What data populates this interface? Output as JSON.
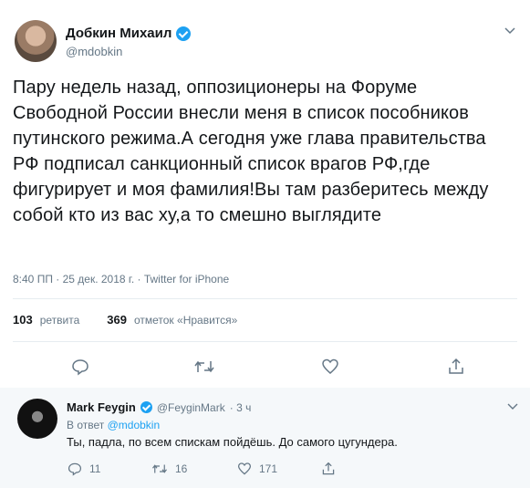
{
  "main_tweet": {
    "author_name": "Добкин Михаил",
    "handle": "@mdobkin",
    "text": "Пару недель назад, оппозиционеры на Форуме Свободной России внесли меня в список пособников путинского режима.А сегодня уже глава правительства РФ подписал санкционный список врагов РФ,где фигурирует и моя фамилия!Вы там разберитесь между собой кто из вас ху,а то смешно выглядите",
    "timestamp_line": "8:40 ПП · 25 дек. 2018 г. · Twitter for iPhone",
    "retweets_count": "103",
    "retweets_label": "ретвита",
    "likes_count": "369",
    "likes_label": "отметок «Нравится»"
  },
  "reply": {
    "author_name": "Mark Feygin",
    "handle": "@FeyginMark",
    "time": "· 3 ч",
    "reply_to_label": "В ответ",
    "reply_to_handle": "@mdobkin",
    "text": "Ты, падла, по всем спискам пойдёшь. До самого цугундера.",
    "replies_count": "11",
    "retweets_count": "16",
    "likes_count": "171"
  },
  "icons": {
    "verified": "verified-badge-icon",
    "caret": "chevron-down-icon",
    "reply": "reply-icon",
    "retweet": "retweet-icon",
    "like": "heart-icon",
    "share": "share-icon"
  },
  "colors": {
    "accent": "#1da1f2",
    "text": "#14171a",
    "muted": "#657786",
    "reply_bg": "#f5f8fa"
  }
}
